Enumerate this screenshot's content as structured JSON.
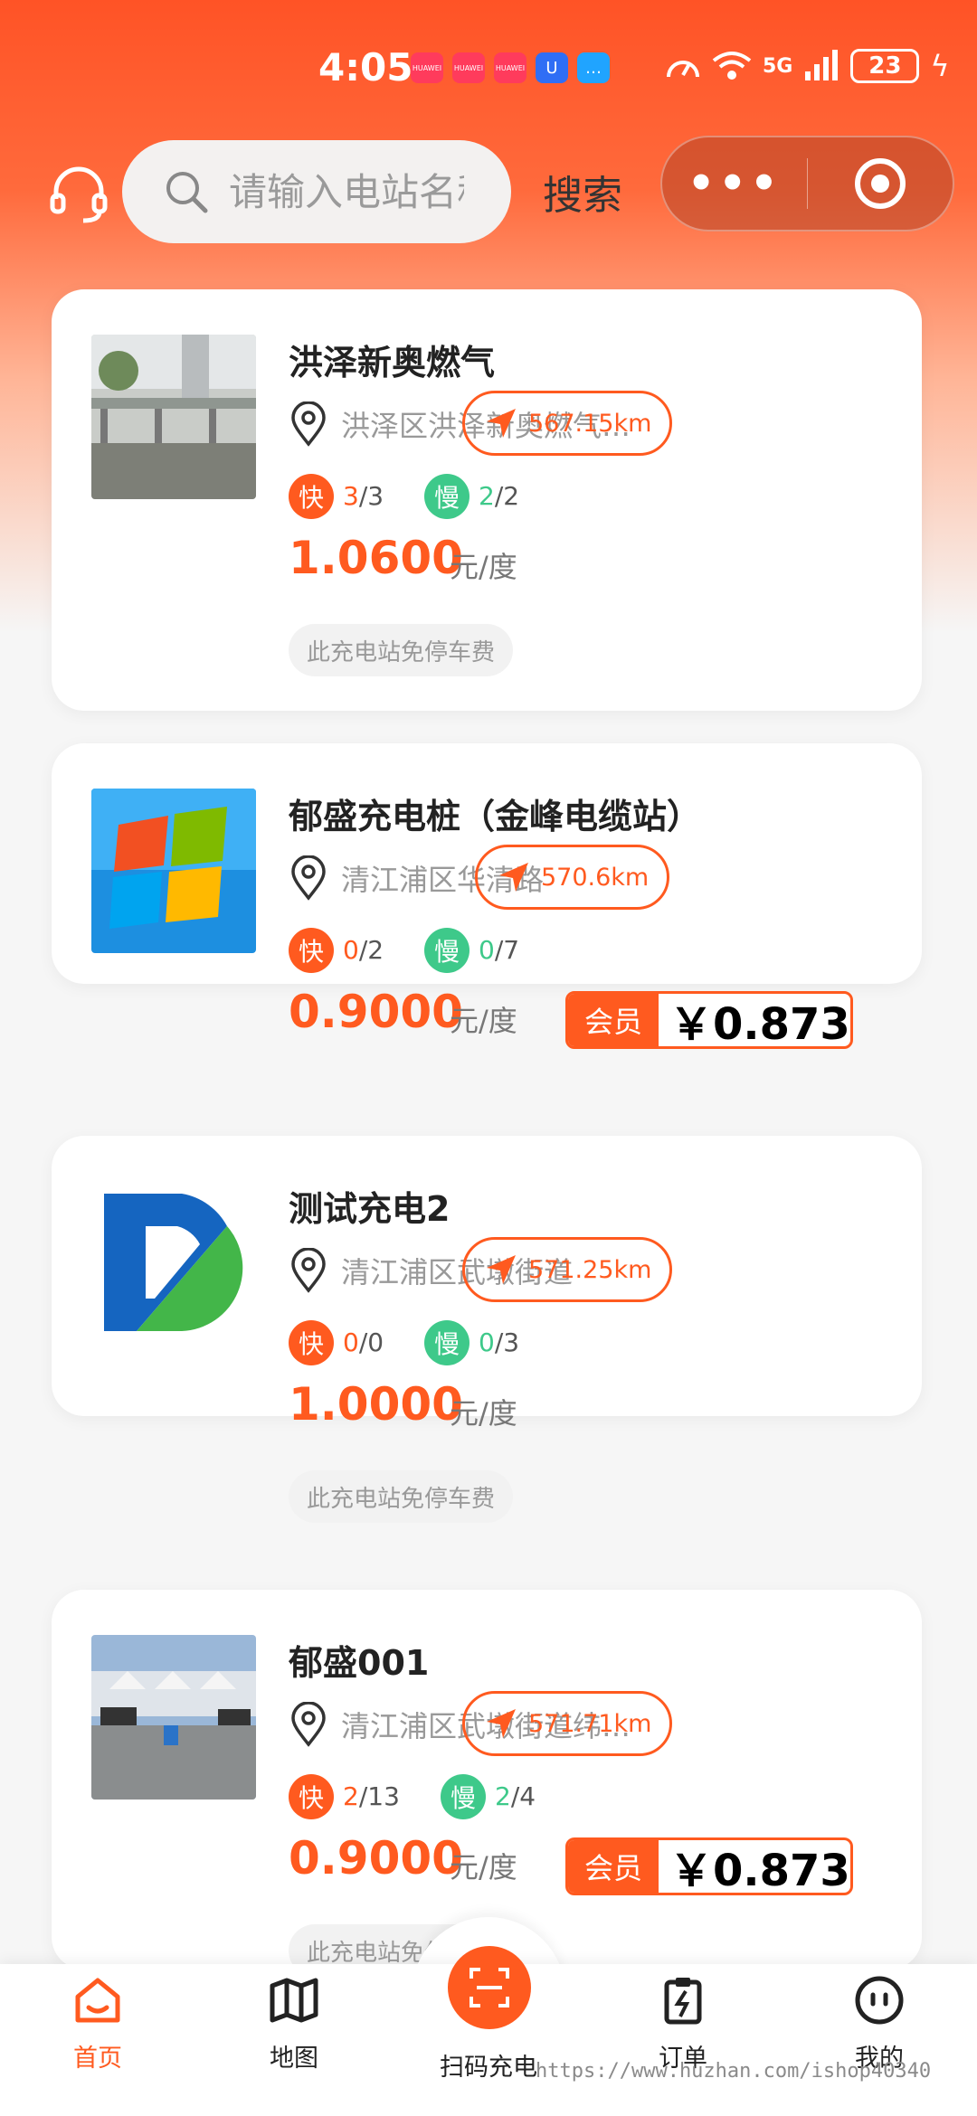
{
  "status_bar": {
    "time": "4:05",
    "notification_labels": [
      "HUAWEI",
      "HUAWEI",
      "HUAWEI"
    ],
    "network": "5G",
    "battery": "23"
  },
  "header": {
    "search_placeholder": "请输入电站名称",
    "search_button": "搜索",
    "capsule_more": "•••"
  },
  "stations": [
    {
      "name": "洪泽新奥燃气",
      "address": "洪泽区洪泽新奥燃气…",
      "distance": "567.15km",
      "fast_label": "快",
      "fast_available": "3",
      "fast_total": "/3",
      "slow_label": "慢",
      "slow_available": "2",
      "slow_total": "/2",
      "price": "1.0600",
      "unit": "元/度",
      "free_parking": "此充电站免停车费"
    },
    {
      "name": "郁盛充电桩（金峰电缆站）",
      "address": "清江浦区华清路",
      "distance": "570.6km",
      "fast_label": "快",
      "fast_available": "0",
      "fast_total": "/2",
      "slow_label": "慢",
      "slow_available": "0",
      "slow_total": "/7",
      "price": "0.9000",
      "unit": "元/度",
      "member_label": "会员",
      "member_price": "￥0.873"
    },
    {
      "name": "测试充电2",
      "address": "清江浦区武墩街道",
      "distance": "571.25km",
      "fast_label": "快",
      "fast_available": "0",
      "fast_total": "/0",
      "slow_label": "慢",
      "slow_available": "0",
      "slow_total": "/3",
      "price": "1.0000",
      "unit": "元/度",
      "free_parking": "此充电站免停车费"
    },
    {
      "name": "郁盛001",
      "address": "清江浦区武墩街道纬…",
      "distance": "571.71km",
      "fast_label": "快",
      "fast_available": "2",
      "fast_total": "/13",
      "slow_label": "慢",
      "slow_available": "2",
      "slow_total": "/4",
      "price": "0.9000",
      "unit": "元/度",
      "member_label": "会员",
      "member_price": "￥0.873",
      "free_parking": "此充电站免停车费"
    }
  ],
  "nav": {
    "home": "首页",
    "map": "地图",
    "scan": "扫码充电",
    "orders": "订单",
    "mine": "我的"
  },
  "watermark": "https://www.huzhan.com/ishop40340",
  "colors": {
    "accent": "#ff5a1f",
    "slow": "#3ec98a",
    "header_gradient_top": "#ff5326"
  }
}
